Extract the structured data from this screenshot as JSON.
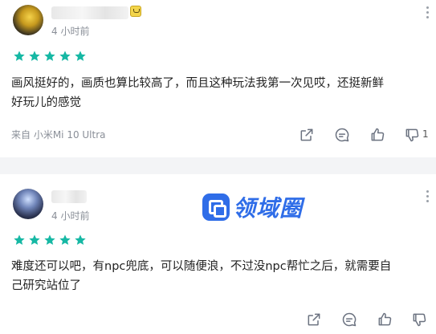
{
  "reviews": [
    {
      "time": "4 小时前",
      "rating": 5,
      "content_lines": [
        "画风挺好的，画质也算比较高了，而且这种玩法我第一次见哎，还挺新鲜",
        "好玩儿的感觉"
      ],
      "device": "来自 小米Mi 10 Ultra",
      "dislike_count": "1"
    },
    {
      "time": "4 小时前",
      "rating": 5,
      "content_lines": [
        "难度还可以吧，有npc兜底，可以随便浪，不过没npc帮忙之后，就需要自",
        "己研究站位了"
      ]
    }
  ],
  "watermark": {
    "text": "领域圈"
  },
  "colors": {
    "star": "#16b8a4",
    "icon": "#6b7280",
    "watermark": "#2f6de8"
  },
  "icons": [
    "share-icon",
    "comment-icon",
    "thumbs-up-icon",
    "thumbs-down-icon",
    "more-icon",
    "star-icon"
  ]
}
